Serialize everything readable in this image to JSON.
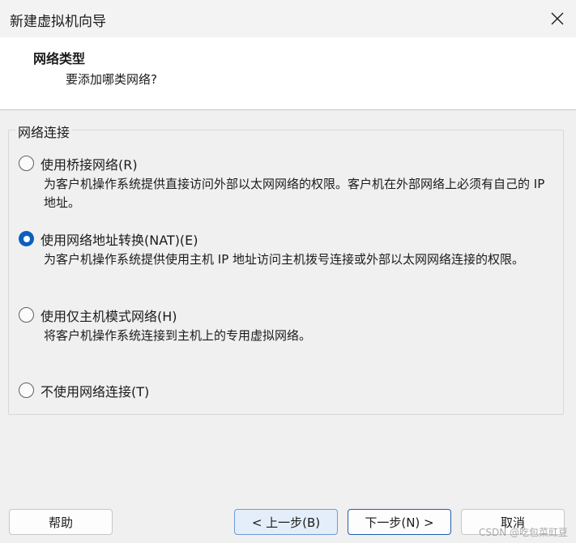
{
  "window": {
    "title": "新建虚拟机向导"
  },
  "header": {
    "title": "网络类型",
    "subtitle": "要添加哪类网络?"
  },
  "group": {
    "legend": "网络连接",
    "options": [
      {
        "label": "使用桥接网络(R)",
        "checked": false,
        "desc": "为客户机操作系统提供直接访问外部以太网网络的权限。客户机在外部网络上必须有自己的 IP 地址。"
      },
      {
        "label": "使用网络地址转换(NAT)(E)",
        "checked": true,
        "desc": "为客户机操作系统提供使用主机 IP 地址访问主机拨号连接或外部以太网网络连接的权限。"
      },
      {
        "label": "使用仅主机模式网络(H)",
        "checked": false,
        "desc": "将客户机操作系统连接到主机上的专用虚拟网络。"
      },
      {
        "label": "不使用网络连接(T)",
        "checked": false,
        "desc": ""
      }
    ]
  },
  "buttons": {
    "help": "帮助",
    "back": "< 上一步(B)",
    "next": "下一步(N) >",
    "cancel": "取消"
  },
  "watermark": "CSDN @吃包菜豇豆"
}
